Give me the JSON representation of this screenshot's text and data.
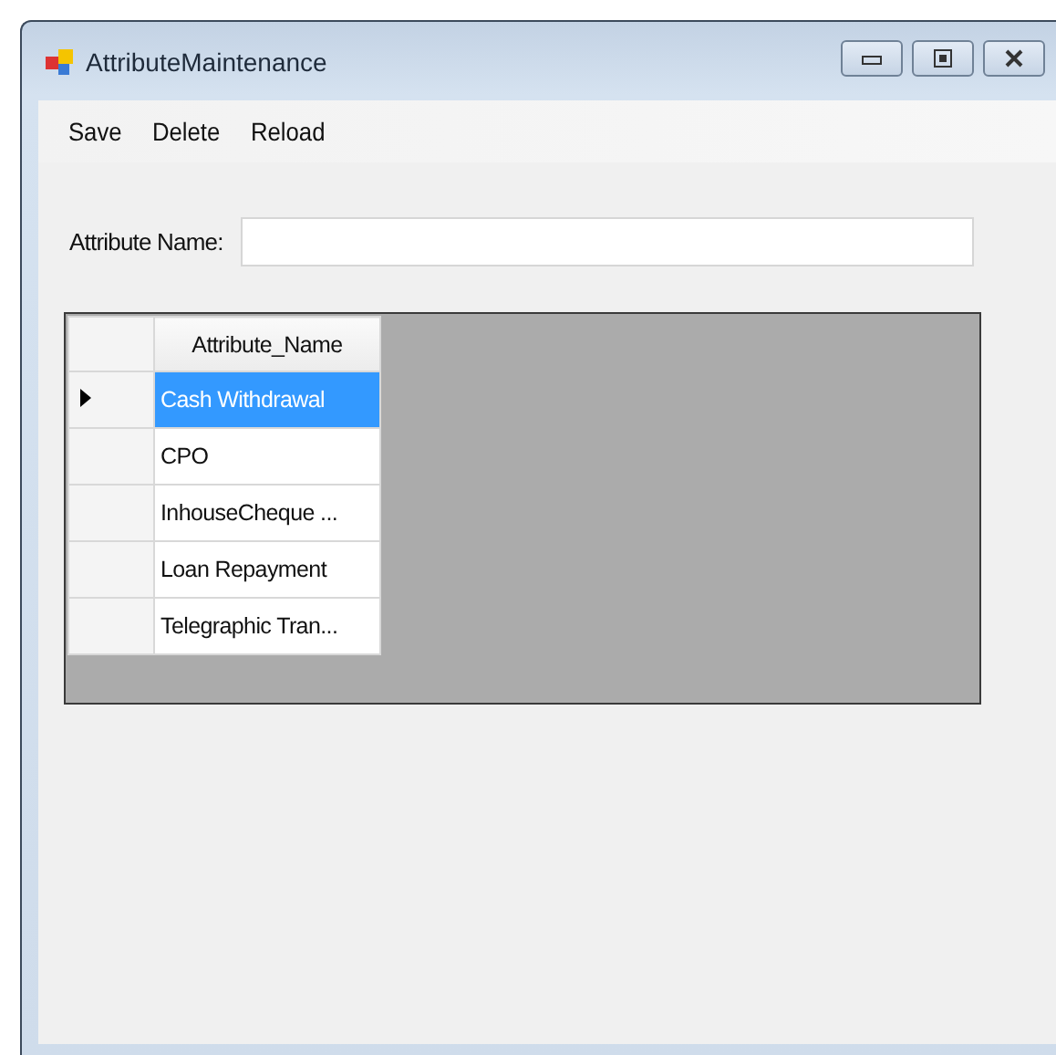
{
  "window": {
    "title": "AttributeMaintenance"
  },
  "menu": [
    {
      "label": "Save"
    },
    {
      "label": "Delete"
    },
    {
      "label": "Reload"
    }
  ],
  "form": {
    "label": "Attribute Name:"
  },
  "grid": {
    "columns": [
      "Attribute_Name"
    ],
    "rows": [
      {
        "cells": [
          "Cash Withdrawal"
        ],
        "selected": true
      },
      {
        "cells": [
          "CPO"
        ],
        "selected": false
      },
      {
        "cells": [
          "InhouseCheque ..."
        ],
        "selected": false
      },
      {
        "cells": [
          "Loan Repayment"
        ],
        "selected": false
      },
      {
        "cells": [
          "Telegraphic Tran..."
        ],
        "selected": false
      }
    ]
  }
}
